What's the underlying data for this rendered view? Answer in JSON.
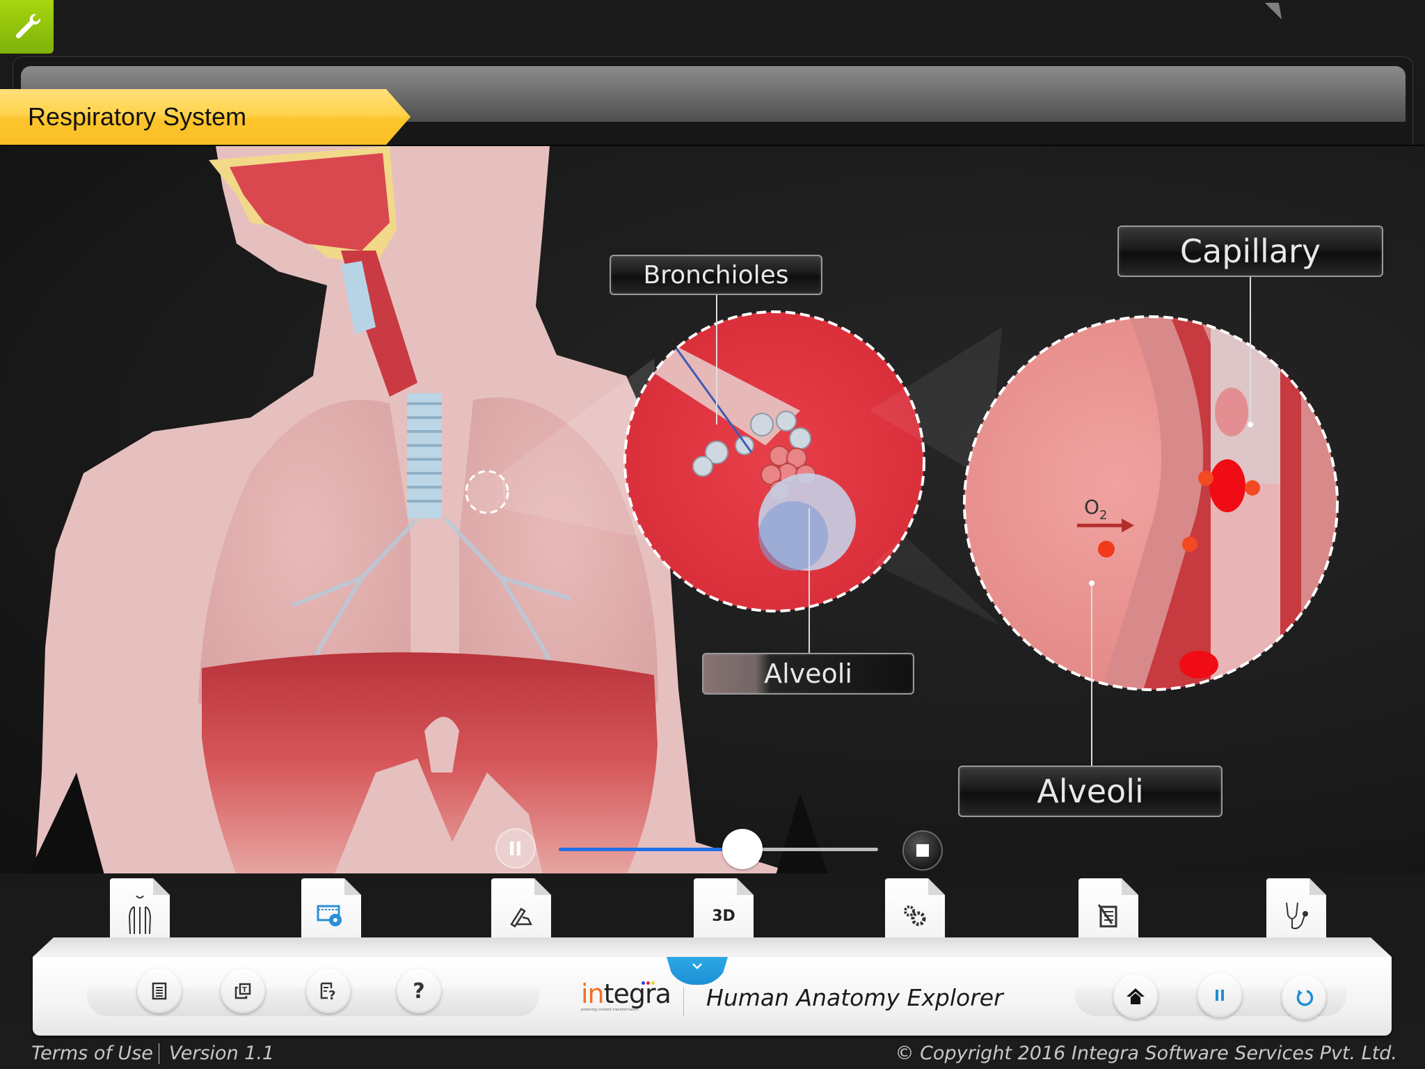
{
  "header": {
    "settings_icon": "wrench-icon",
    "title": "Respiratory System"
  },
  "viewer": {
    "labels": {
      "bronchioles": "Bronchioles",
      "capillary": "Capillary",
      "alveoli_mid": "Alveoli",
      "alveoli_right": "Alveoli",
      "oxygen": "O",
      "oxygen_sub": "2"
    },
    "media": {
      "pause_icon": "pause-icon",
      "stop_icon": "stop-icon",
      "progress": 0.575
    }
  },
  "tabs": [
    {
      "name": "anatomy",
      "icon": "human-body-icon"
    },
    {
      "name": "video",
      "icon": "film-reel-icon"
    },
    {
      "name": "annotate",
      "icon": "pen-hand-icon"
    },
    {
      "name": "3d",
      "icon": "3d-icon",
      "label": "3D"
    },
    {
      "name": "process",
      "icon": "gears-icon"
    },
    {
      "name": "notes",
      "icon": "notepad-icon"
    },
    {
      "name": "diagnosis",
      "icon": "stethoscope-icon"
    }
  ],
  "toolbar": {
    "left_buttons": [
      {
        "name": "document",
        "icon": "document-icon"
      },
      {
        "name": "text-copy",
        "icon": "text-box-icon"
      },
      {
        "name": "quiz",
        "icon": "quiz-icon"
      },
      {
        "name": "help",
        "icon": "question-icon",
        "label": "?"
      }
    ],
    "right_buttons": [
      {
        "name": "home",
        "icon": "home-icon"
      },
      {
        "name": "pause",
        "icon": "pause-icon"
      },
      {
        "name": "replay",
        "icon": "replay-icon"
      }
    ],
    "dropdown_icon": "chevron-down-icon",
    "logo_in": "in",
    "logo_rest": "tegra",
    "logo_tagline": "powering content transformation",
    "app_name": "Human Anatomy Explorer",
    "accent_color": "#1d8fd4"
  },
  "footer": {
    "terms": "Terms of Use",
    "version": "Version 1.1",
    "copyright": "© Copyright 2016 Integra Software Services Pvt. Ltd."
  }
}
